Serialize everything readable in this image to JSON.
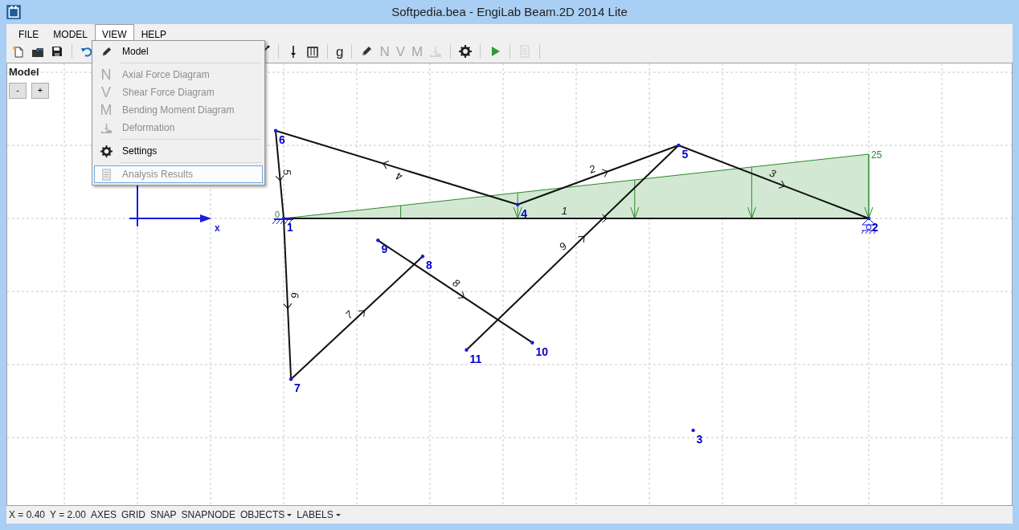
{
  "window": {
    "title": "Softpedia.bea - EngiLab Beam.2D 2014 Lite"
  },
  "menu_bar": [
    {
      "label": "FILE",
      "selected": false
    },
    {
      "label": "MODEL",
      "selected": false
    },
    {
      "label": "VIEW",
      "selected": true
    },
    {
      "label": "HELP",
      "selected": false
    }
  ],
  "toolbar_left": [
    {
      "kind": "icon",
      "disabled": false
    },
    {
      "kind": "icon",
      "disabled": false
    },
    {
      "kind": "icon",
      "disabled": false
    },
    {
      "kind": "separator"
    },
    {
      "kind": "icon",
      "disabled": false
    }
  ],
  "toolbar_right": [
    {
      "kind": "icon",
      "disabled": false
    },
    {
      "kind": "separator"
    },
    {
      "kind": "icon",
      "disabled": false
    },
    {
      "kind": "icon",
      "disabled": false
    },
    {
      "kind": "separator"
    },
    {
      "kind": "glyph",
      "text": "g",
      "disabled": false
    },
    {
      "kind": "separator"
    },
    {
      "kind": "icon",
      "disabled": false
    },
    {
      "kind": "glyph",
      "text": "N",
      "disabled": true
    },
    {
      "kind": "glyph",
      "text": "V",
      "disabled": true
    },
    {
      "kind": "glyph",
      "text": "M",
      "disabled": true
    },
    {
      "kind": "icon",
      "disabled": true
    },
    {
      "kind": "separator"
    },
    {
      "kind": "icon",
      "disabled": false
    },
    {
      "kind": "separator"
    },
    {
      "kind": "icon",
      "disabled": false
    },
    {
      "kind": "separator"
    },
    {
      "kind": "icon",
      "disabled": true
    },
    {
      "kind": "separator"
    }
  ],
  "view_menu": [
    {
      "kind": "item",
      "label": "Model",
      "disabled": false,
      "highlighted": false
    },
    {
      "kind": "separator"
    },
    {
      "kind": "item",
      "glyph": "N",
      "label": "Axial Force Diagram",
      "disabled": true,
      "highlighted": false
    },
    {
      "kind": "item",
      "glyph": "V",
      "label": "Shear Force Diagram",
      "disabled": true,
      "highlighted": false
    },
    {
      "kind": "item",
      "glyph": "M",
      "label": "Bending Moment Diagram",
      "disabled": true,
      "highlighted": false
    },
    {
      "kind": "item",
      "label": "Deformation",
      "disabled": true,
      "highlighted": false
    },
    {
      "kind": "separator"
    },
    {
      "kind": "item",
      "label": "Settings",
      "disabled": false,
      "highlighted": false
    },
    {
      "kind": "separator"
    },
    {
      "kind": "item",
      "label": "Analysis Results",
      "disabled": true,
      "highlighted": true
    }
  ],
  "side_panel": {
    "title": "Model",
    "buttons": [
      "-",
      "+"
    ]
  },
  "model": {
    "axes": {
      "x_label": "x"
    },
    "nodes": [
      {
        "label": "1",
        "kind": "fixed"
      },
      {
        "label": "2",
        "kind": "roller"
      },
      {
        "label": "3",
        "kind": "free"
      },
      {
        "label": "4",
        "kind": "free"
      },
      {
        "label": "5",
        "kind": "free"
      },
      {
        "label": "6",
        "kind": "free"
      },
      {
        "label": "7",
        "kind": "free"
      },
      {
        "label": "8",
        "kind": "free"
      },
      {
        "label": "9",
        "kind": "free"
      },
      {
        "label": "10",
        "kind": "free"
      },
      {
        "label": "11",
        "kind": "free"
      }
    ],
    "elements": [
      {
        "label": "1"
      },
      {
        "label": "2"
      },
      {
        "label": "3"
      },
      {
        "label": "4"
      },
      {
        "label": "5"
      },
      {
        "label": "6"
      },
      {
        "label": "7"
      },
      {
        "label": "8"
      },
      {
        "label": "9"
      }
    ],
    "distributed_load": {
      "start_label": "0",
      "end_label": "25"
    }
  },
  "status_bar": [
    {
      "kind": "text",
      "label": "X = 0.40"
    },
    {
      "kind": "text",
      "label": "Y = 2.00"
    },
    {
      "kind": "text",
      "label": "AXES"
    },
    {
      "kind": "text",
      "label": "GRID"
    },
    {
      "kind": "text",
      "label": "SNAP"
    },
    {
      "kind": "text",
      "label": "SNAPNODE"
    },
    {
      "kind": "dropdown",
      "label": "OBJECTS"
    },
    {
      "kind": "dropdown",
      "label": "LABELS"
    }
  ]
}
